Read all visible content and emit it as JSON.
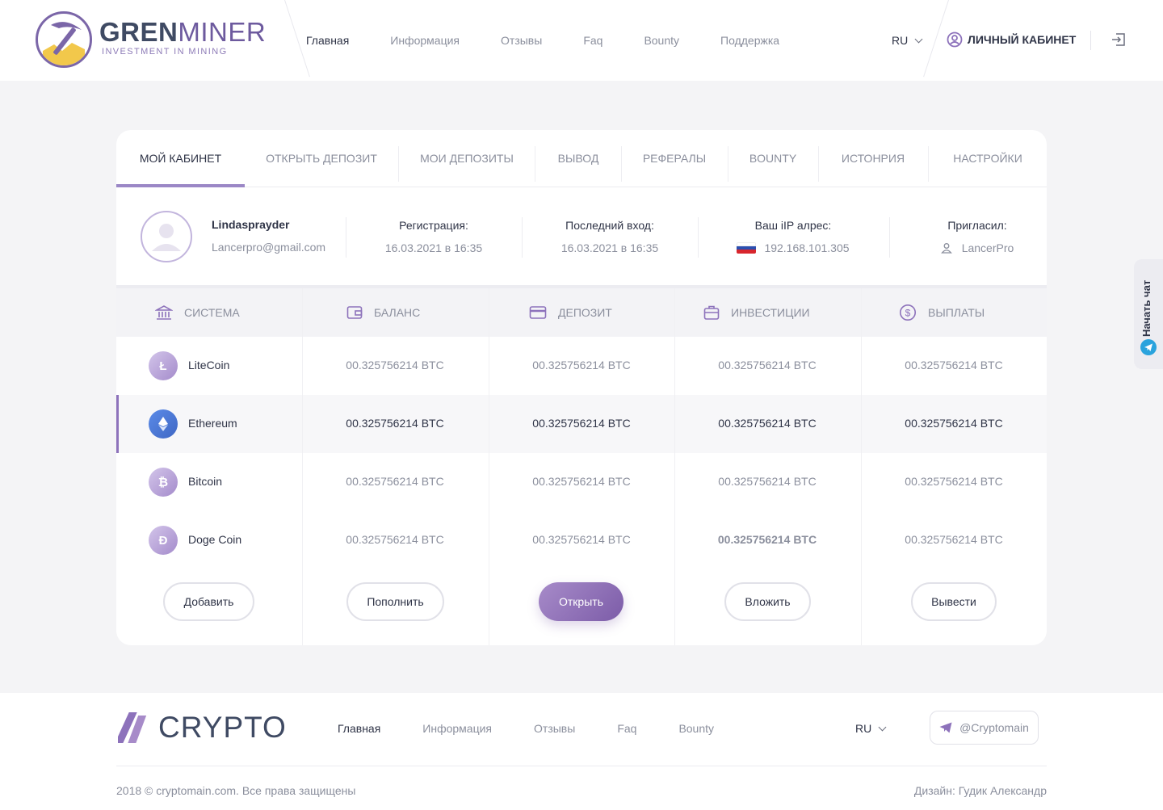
{
  "brand": {
    "name_bold": "GREN",
    "name_light": "MINER",
    "tagline": "INVESTMENT IN MINING"
  },
  "nav": {
    "items": [
      "Главная",
      "Информация",
      "Отзывы",
      "Faq",
      "Bounty",
      "Поддержка"
    ],
    "active": "Главная"
  },
  "header": {
    "lang": "RU",
    "cabinet_label": "ЛИЧНЫЙ КАБИНЕТ"
  },
  "tabs": [
    "МОЙ КАБИНЕТ",
    "ОТКРЫТЬ ДЕПОЗИТ",
    "МОИ ДЕПОЗИТЫ",
    "ВЫВОД",
    "РЕФЕРАЛЫ",
    "BOUNTY",
    "ИСТОНРИЯ",
    "НАСТРОЙКИ"
  ],
  "active_tab": "МОЙ КАБИНЕТ",
  "profile": {
    "username": "Lindasprayder",
    "email": "Lancerpro@gmail.com",
    "registration_label": "Регистрация:",
    "registration_value": "16.03.2021 в 16:35",
    "last_login_label": "Последний вход:",
    "last_login_value": "16.03.2021 в 16:35",
    "ip_label": "Ваш iIP алрес:",
    "ip_value": "192.168.101.305",
    "invited_label": "Пригласил:",
    "invited_value": "LancerPro"
  },
  "table": {
    "headers": [
      "СИСТЕМА",
      "БАЛАНС",
      "ДЕПОЗИТ",
      "ИНВЕСТИЦИИ",
      "ВЫПЛАТЫ"
    ],
    "rows": [
      {
        "name": "LiteCoin",
        "balance": "00.325756214 BTC",
        "deposit": "00.325756214 BTC",
        "invest": "00.325756214 BTC",
        "payout": "00.325756214 BTC"
      },
      {
        "name": "Ethereum",
        "balance": "00.325756214 BTC",
        "deposit": "00.325756214 BTC",
        "invest": "00.325756214 BTC",
        "payout": "00.325756214 BTC"
      },
      {
        "name": "Bitcoin",
        "balance": "00.325756214 BTC",
        "deposit": "00.325756214 BTC",
        "invest": "00.325756214 BTC",
        "payout": "00.325756214 BTC"
      },
      {
        "name": "Doge Coin",
        "balance": "00.325756214 BTC",
        "deposit": "00.325756214 BTC",
        "invest": "00.325756214 BTC",
        "payout": "00.325756214 BTC"
      }
    ],
    "selected_row": "Ethereum"
  },
  "actions": {
    "add": "Добавить",
    "topup": "Пополнить",
    "open": "Открыть",
    "invest": "Вложить",
    "withdraw": "Вывести"
  },
  "chat": {
    "label": "Начать чат"
  },
  "footer": {
    "brand": "CRYPTO",
    "nav": [
      "Главная",
      "Информация",
      "Отзывы",
      "Faq",
      "Bounty"
    ],
    "lang": "RU",
    "telegram": "@Cryptomain",
    "copyright": "2018 © cryptomain.com.  Все права защищены",
    "design": "Дизайн: Гудик Александр"
  },
  "colors": {
    "accent": "#8d72bb",
    "primary_button_start": "#a78bc9",
    "primary_button_end": "#7c5ca8",
    "ethereum": "#4a74d4",
    "telegram": "#2aa3dd"
  }
}
